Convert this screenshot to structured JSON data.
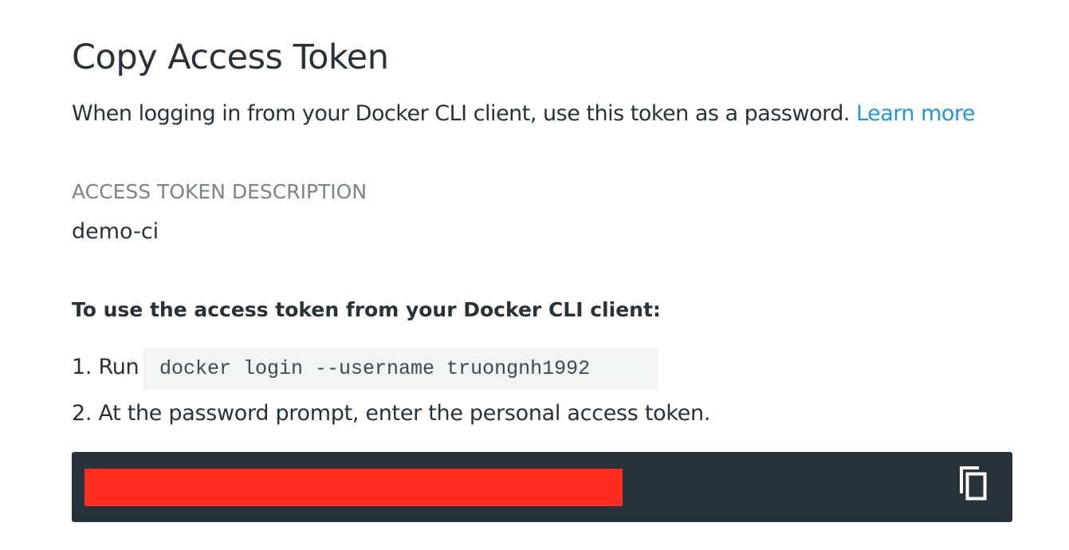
{
  "dialog": {
    "title": "Copy Access Token",
    "intro_text": "When logging in from your Docker CLI client, use this token as a password. ",
    "learn_more_label": "Learn more",
    "link_color": "#1e96e6"
  },
  "token_description": {
    "label": "ACCESS TOKEN DESCRIPTION",
    "value": "demo-ci"
  },
  "instructions": {
    "heading": "To use the access token from your Docker CLI client:",
    "step1_prefix": "1. Run",
    "step1_command": "docker login --username truongnh1992",
    "step2_text": "2. At the password prompt, enter the personal access token."
  },
  "token_panel": {
    "background_color": "#27323b",
    "redaction_color": "#ff2d1f",
    "copy_icon": "copy-icon"
  }
}
